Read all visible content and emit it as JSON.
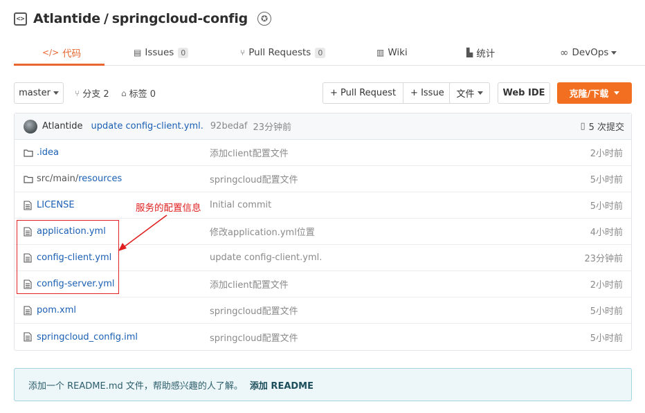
{
  "repo": {
    "owner": "Atlantide",
    "separator": "/",
    "name": "springcloud-config"
  },
  "tabs": [
    {
      "icon": "code-icon",
      "label": "代码",
      "active": true
    },
    {
      "icon": "issues-icon",
      "label": "Issues",
      "count": "0"
    },
    {
      "icon": "pull-request-icon",
      "label": "Pull Requests",
      "count": "0"
    },
    {
      "icon": "wiki-icon",
      "label": "Wiki"
    },
    {
      "icon": "stats-icon",
      "label": "统计"
    },
    {
      "icon": "devops-icon",
      "label": "DevOps"
    }
  ],
  "toolbar": {
    "branch": "master",
    "branches": "分支 2",
    "tags": "标签 0",
    "pull_request": "+ Pull Request",
    "issue": "+ Issue",
    "files": "文件",
    "web_ide": "Web IDE",
    "clone": "克隆/下载"
  },
  "commit": {
    "author": "Atlantide",
    "message": "update config-client.yml.",
    "sha": "92bedaf",
    "time": "23分钟前",
    "count": "5 次提交"
  },
  "files": [
    {
      "type": "folder",
      "name": ".idea",
      "message": "添加client配置文件",
      "time": "2小时前"
    },
    {
      "type": "folder",
      "name_prefix": "src/main/",
      "name": "resources",
      "message": "springcloud配置文件",
      "time": "5小时前"
    },
    {
      "type": "file",
      "name": "LICENSE",
      "message": "Initial commit",
      "time": "5小时前"
    },
    {
      "type": "file",
      "name": "application.yml",
      "message": "修改application.yml位置",
      "time": "4小时前"
    },
    {
      "type": "file",
      "name": "config-client.yml",
      "message": "update config-client.yml.",
      "time": "23分钟前"
    },
    {
      "type": "file",
      "name": "config-server.yml",
      "message": "添加client配置文件",
      "time": "2小时前"
    },
    {
      "type": "file",
      "name": "pom.xml",
      "message": "springcloud配置文件",
      "time": "5小时前"
    },
    {
      "type": "file",
      "name": "springcloud_config.iml",
      "message": "springcloud配置文件",
      "time": "5小时前"
    }
  ],
  "annotation": {
    "text": "服务的配置信息",
    "color": "#e02020"
  },
  "readme_notice": {
    "text": "添加一个 README.md 文件，帮助感兴趣的人了解。",
    "link": "添加 README"
  },
  "colors": {
    "accent": "#e8662f",
    "link": "#1a5fb4",
    "clone_button": "#f26f21"
  }
}
